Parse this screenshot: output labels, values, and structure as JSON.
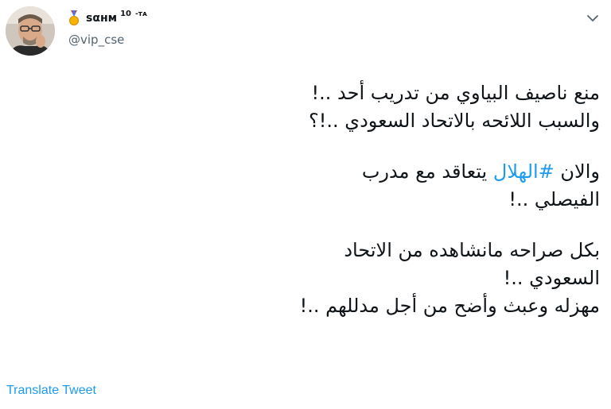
{
  "tweet": {
    "display_name": "ѕαнм",
    "superscript": "10",
    "name_tag": "-ᴛᴀ",
    "handle": "@vip_cse",
    "lines": {
      "l1": "منع ناصيف البياوي من تدريب أحد ..!",
      "l2": "والسبب اللائحه بالاتحاد السعودي ..!؟",
      "l3_start": "والان ",
      "hashtag": "#الهلال",
      "l3_end": " يتعاقد مع مدرب",
      "l4": "الفيصلي ..!",
      "l5": "بكل صراحه مانشاهده من الاتحاد",
      "l6": "السعودي ..!",
      "l7": "مهزله وعبث وأضح من أجل مدللهم ..!"
    },
    "translate_label": "Translate Tweet"
  },
  "icons": {
    "medal": "medal-icon",
    "chevron": "chevron-down-icon"
  },
  "colors": {
    "link": "#1d9bf0",
    "text": "#0f1419",
    "muted": "#536471"
  }
}
